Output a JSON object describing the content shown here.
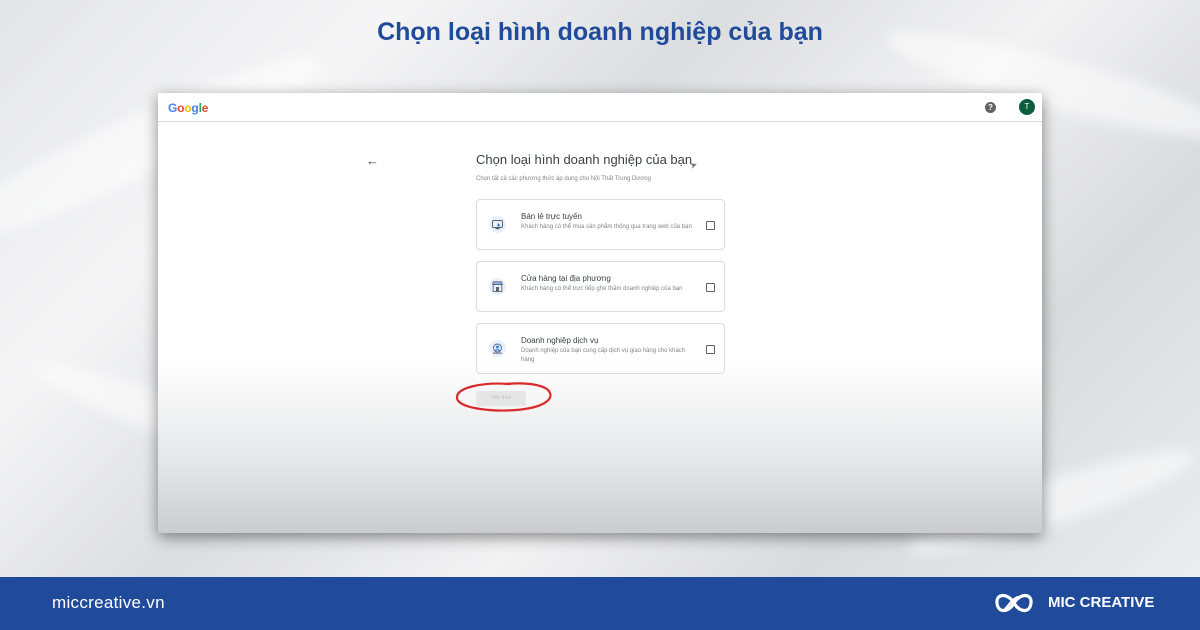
{
  "headline": "Chọn loại hình doanh nghiệp của bạn",
  "browser": {
    "logo_letters": [
      {
        "char": "G",
        "color": "#4285F4"
      },
      {
        "char": "o",
        "color": "#EA4335"
      },
      {
        "char": "o",
        "color": "#FBBC05"
      },
      {
        "char": "g",
        "color": "#4285F4"
      },
      {
        "char": "l",
        "color": "#34A853"
      },
      {
        "char": "e",
        "color": "#EA4335"
      }
    ],
    "help_label": "?",
    "avatar_initial": "T"
  },
  "page": {
    "back_label": "←",
    "title": "Chọn loại hình doanh nghiệp của bạn",
    "subtitle": "Chọn tất cả các phương thức áp dụng cho Nội Thất Trung Dương",
    "options": [
      {
        "title": "Bán lẻ trực tuyến",
        "description": "Khách hàng có thể mua sản phẩm thông qua trang web của bạn",
        "icon": "online-retail-icon",
        "checked": false
      },
      {
        "title": "Cửa hàng tại địa phương",
        "description": "Khách hàng có thể trực tiếp ghé thăm doanh nghiệp của bạn",
        "icon": "storefront-icon",
        "checked": false
      },
      {
        "title": "Doanh nghiệp dịch vụ",
        "description": "Doanh nghiệp của bạn cung cấp dịch vụ giao hàng cho khách hàng",
        "icon": "service-business-icon",
        "checked": false
      }
    ],
    "continue_label": "Tiếp theo"
  },
  "footer": {
    "url": "miccreative.vn",
    "brand": "MIC CREATIVE"
  },
  "colors": {
    "brand_blue": "#1f4b9a",
    "annotation_red": "#d92b2b",
    "avatar_green": "#0d5c3b"
  }
}
